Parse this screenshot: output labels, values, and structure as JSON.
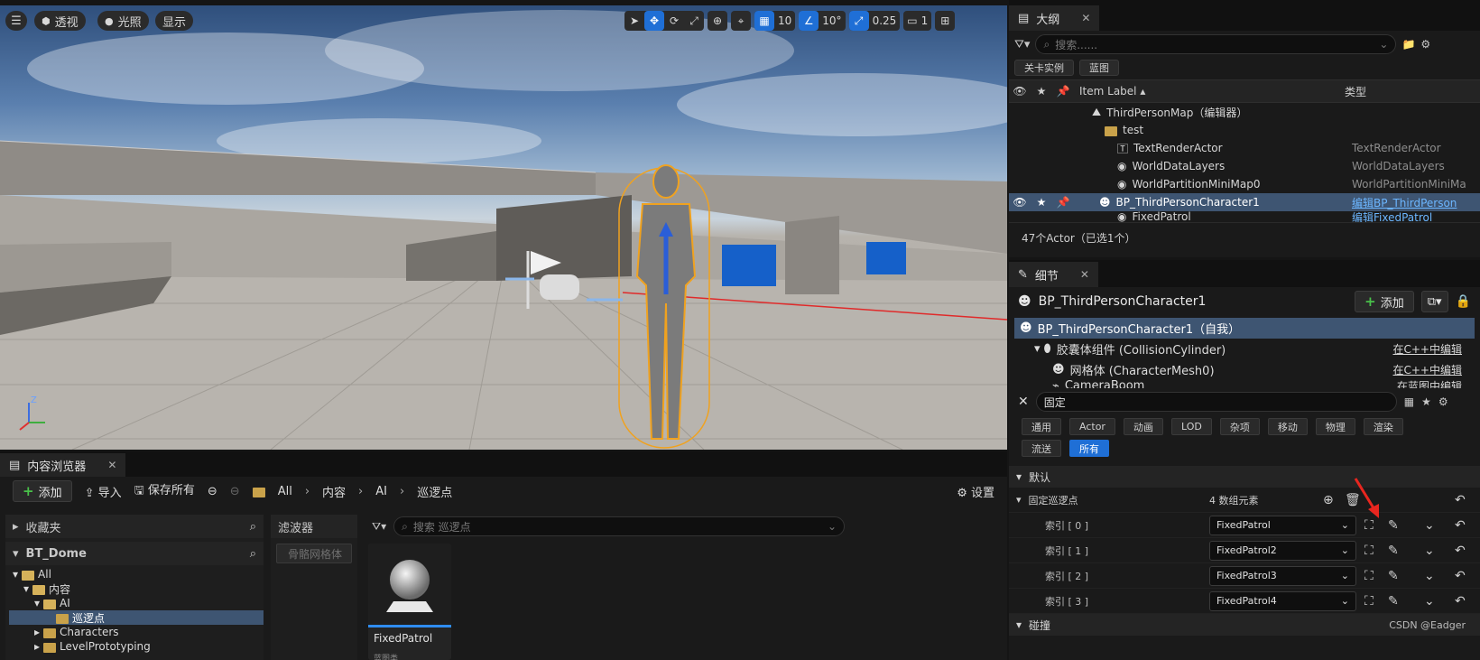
{
  "viewport": {
    "menu_icon": "menu-icon",
    "perspective_label": "透视",
    "lighting_label": "光照",
    "show_label": "显示",
    "grid_value": "10",
    "angle_value": "10°",
    "scale_value": "0.25",
    "camera_speed": "1",
    "axis_z_label": "Z"
  },
  "outliner": {
    "tab_title": "大纲",
    "search_placeholder": "搜索......",
    "chips": [
      "关卡实例",
      "蓝图"
    ],
    "col_label": "Item Label",
    "col_type": "类型",
    "rows": [
      {
        "label": "ThirdPersonMap（编辑器）",
        "type": ""
      },
      {
        "label": "test",
        "type": ""
      },
      {
        "label": "TextRenderActor",
        "type": "TextRenderActor"
      },
      {
        "label": "WorldDataLayers",
        "type": "WorldDataLayers"
      },
      {
        "label": "WorldPartitionMiniMap0",
        "type": "WorldPartitionMiniMa"
      },
      {
        "label": "BP_ThirdPersonCharacter1",
        "type": "编辑BP_ThirdPerson"
      },
      {
        "label": "FixedPatrol",
        "type": "编辑FixedPatrol"
      }
    ],
    "status": "47个Actor（已选1个）"
  },
  "details": {
    "tab_title": "细节",
    "actor_name": "BP_ThirdPersonCharacter1",
    "add_label": "添加",
    "components": [
      {
        "label": "BP_ThirdPersonCharacter1（自我）",
        "edit": ""
      },
      {
        "label": "胶囊体组件 (CollisionCylinder)",
        "edit": "在C++中编辑"
      },
      {
        "label": "网格体 (CharacterMesh0)",
        "edit": "在C++中编辑"
      },
      {
        "label": "CameraBoom",
        "edit": "在蓝图中编辑"
      }
    ],
    "search_value": "固定",
    "filters": [
      "通用",
      "Actor",
      "动画",
      "LOD",
      "杂项",
      "移动",
      "物理",
      "渲染",
      "流送",
      "所有"
    ],
    "section_default": "默认",
    "array_label": "固定巡逻点",
    "array_count": "4 数组元素",
    "elements": [
      {
        "index": "索引 [ 0 ]",
        "value": "FixedPatrol"
      },
      {
        "index": "索引 [ 1 ]",
        "value": "FixedPatrol2"
      },
      {
        "index": "索引 [ 2 ]",
        "value": "FixedPatrol3"
      },
      {
        "index": "索引 [ 3 ]",
        "value": "FixedPatrol4"
      }
    ],
    "section_collision": "碰撞",
    "watermark": "CSDN @Eadger"
  },
  "content_browser": {
    "tab_title": "内容浏览器",
    "add_label": "添加",
    "import_label": "导入",
    "save_all_label": "保存所有",
    "breadcrumb": [
      "All",
      "内容",
      "AI",
      "巡逻点"
    ],
    "settings_label": "设置",
    "favorites_label": "收藏夹",
    "project_label": "BT_Dome",
    "tree": [
      "All",
      "内容",
      "AI",
      "巡逻点",
      "Characters",
      "LevelPrototyping"
    ],
    "filter_label": "滤波器",
    "filter_item": "骨骼网格体",
    "search_placeholder": "搜索 巡逻点",
    "asset_name": "FixedPatrol",
    "asset_type": "蓝图类"
  },
  "colors": {
    "accent": "#1f6fd6",
    "selection": "#3e5572",
    "add_green": "#49c24a"
  }
}
